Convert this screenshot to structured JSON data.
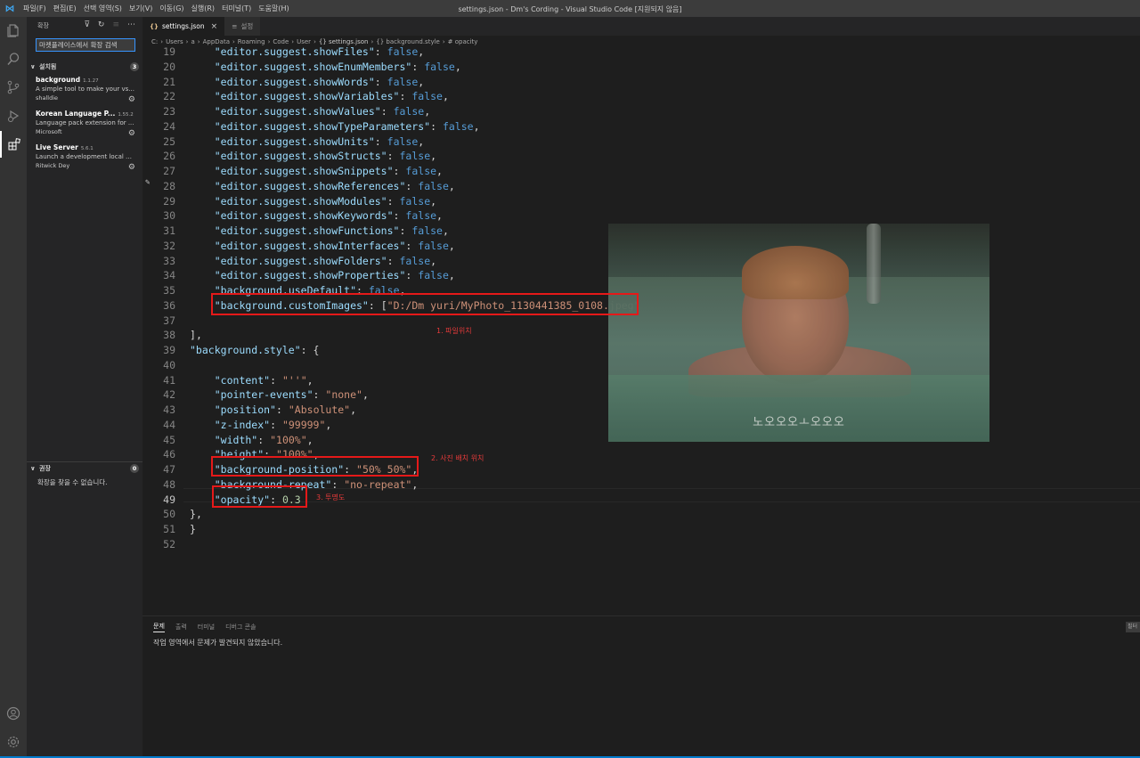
{
  "titlebar": {
    "menu": [
      "파일(F)",
      "편집(E)",
      "선택 영역(S)",
      "보기(V)",
      "이동(G)",
      "실행(R)",
      "터미널(T)",
      "도움말(H)"
    ],
    "title": "settings.json - Dm's Cording - Visual Studio Code [지원되지 않음]"
  },
  "sidebar": {
    "header": "확장",
    "search_value": "마켓플레이스에서 확장 검색",
    "installed": {
      "title": "설치됨",
      "count": "3",
      "items": [
        {
          "name": "background",
          "version": "1.1.27",
          "desc": "A simple tool to make your vs...",
          "publisher": "shalldie"
        },
        {
          "name": "Korean Language P...",
          "version": "1.55.2",
          "desc": "Language pack extension for ...",
          "publisher": "Microsoft"
        },
        {
          "name": "Live Server",
          "version": "5.6.1",
          "desc": "Launch a development local S...",
          "publisher": "Ritwick Dey"
        }
      ]
    },
    "recommended": {
      "title": "권장",
      "count": "0",
      "empty": "확장을 찾을 수 없습니다."
    }
  },
  "tabs": [
    {
      "label": "settings.json",
      "icon": "{}",
      "active": true
    },
    {
      "label": "설정",
      "icon": "≡",
      "active": false
    }
  ],
  "breadcrumb": [
    "C:",
    "Users",
    "a",
    "AppData",
    "Roaming",
    "Code",
    "User",
    "{} settings.json",
    "{} background.style",
    "# opacity"
  ],
  "editor": {
    "lines": [
      {
        "n": "19",
        "code": "    \"editor.suggest.showFiles\": false,"
      },
      {
        "n": "20",
        "code": "    \"editor.suggest.showEnumMembers\": false,"
      },
      {
        "n": "21",
        "code": "    \"editor.suggest.showWords\": false,"
      },
      {
        "n": "22",
        "code": "    \"editor.suggest.showVariables\": false,"
      },
      {
        "n": "23",
        "code": "    \"editor.suggest.showValues\": false,"
      },
      {
        "n": "24",
        "code": "    \"editor.suggest.showTypeParameters\": false,"
      },
      {
        "n": "25",
        "code": "    \"editor.suggest.showUnits\": false,"
      },
      {
        "n": "26",
        "code": "    \"editor.suggest.showStructs\": false,"
      },
      {
        "n": "27",
        "code": "    \"editor.suggest.showSnippets\": false,"
      },
      {
        "n": "28",
        "code": "    \"editor.suggest.showReferences\": false,"
      },
      {
        "n": "29",
        "code": "    \"editor.suggest.showModules\": false,"
      },
      {
        "n": "30",
        "code": "    \"editor.suggest.showKeywords\": false,"
      },
      {
        "n": "31",
        "code": "    \"editor.suggest.showFunctions\": false,"
      },
      {
        "n": "32",
        "code": "    \"editor.suggest.showInterfaces\": false,"
      },
      {
        "n": "33",
        "code": "    \"editor.suggest.showFolders\": false,"
      },
      {
        "n": "34",
        "code": "    \"editor.suggest.showProperties\": false,"
      },
      {
        "n": "35",
        "code": "    \"background.useDefault\": false,"
      },
      {
        "n": "36",
        "code": "    \"background.customImages\": [\"D:/Dm yuri/MyPhoto_1130441385_0108.jpeg\""
      },
      {
        "n": "37",
        "code": ""
      },
      {
        "n": "38",
        "code": "],"
      },
      {
        "n": "39",
        "code": "\"background.style\": {"
      },
      {
        "n": "40",
        "code": ""
      },
      {
        "n": "41",
        "code": "    \"content\": \"''\","
      },
      {
        "n": "42",
        "code": "    \"pointer-events\": \"none\","
      },
      {
        "n": "43",
        "code": "    \"position\": \"Absolute\","
      },
      {
        "n": "44",
        "code": "    \"z-index\": \"99999\","
      },
      {
        "n": "45",
        "code": "    \"width\": \"100%\","
      },
      {
        "n": "46",
        "code": "    \"height\": \"100%\","
      },
      {
        "n": "47",
        "code": "    \"background-position\": \"50% 50%\","
      },
      {
        "n": "48",
        "code": "    \"background-repeat\": \"no-repeat\","
      },
      {
        "n": "49",
        "code": "    \"opacity\": 0.3"
      },
      {
        "n": "50",
        "code": "},"
      },
      {
        "n": "51",
        "code": "}"
      },
      {
        "n": "52",
        "code": ""
      }
    ],
    "current_line": "49",
    "photo_caption": "노오오오ㅗ오오오"
  },
  "annotations": [
    "1. 파일위치",
    "2. 사진 배치 위치",
    "3. 투명도"
  ],
  "panel": {
    "tabs": [
      "문제",
      "출력",
      "터미널",
      "디버그 콘솔"
    ],
    "message": "작업 영역에서 문제가 발견되지 않았습니다.",
    "filter": "필터"
  },
  "colors": {
    "accent": "#007acc",
    "annotation": "#e51919"
  }
}
